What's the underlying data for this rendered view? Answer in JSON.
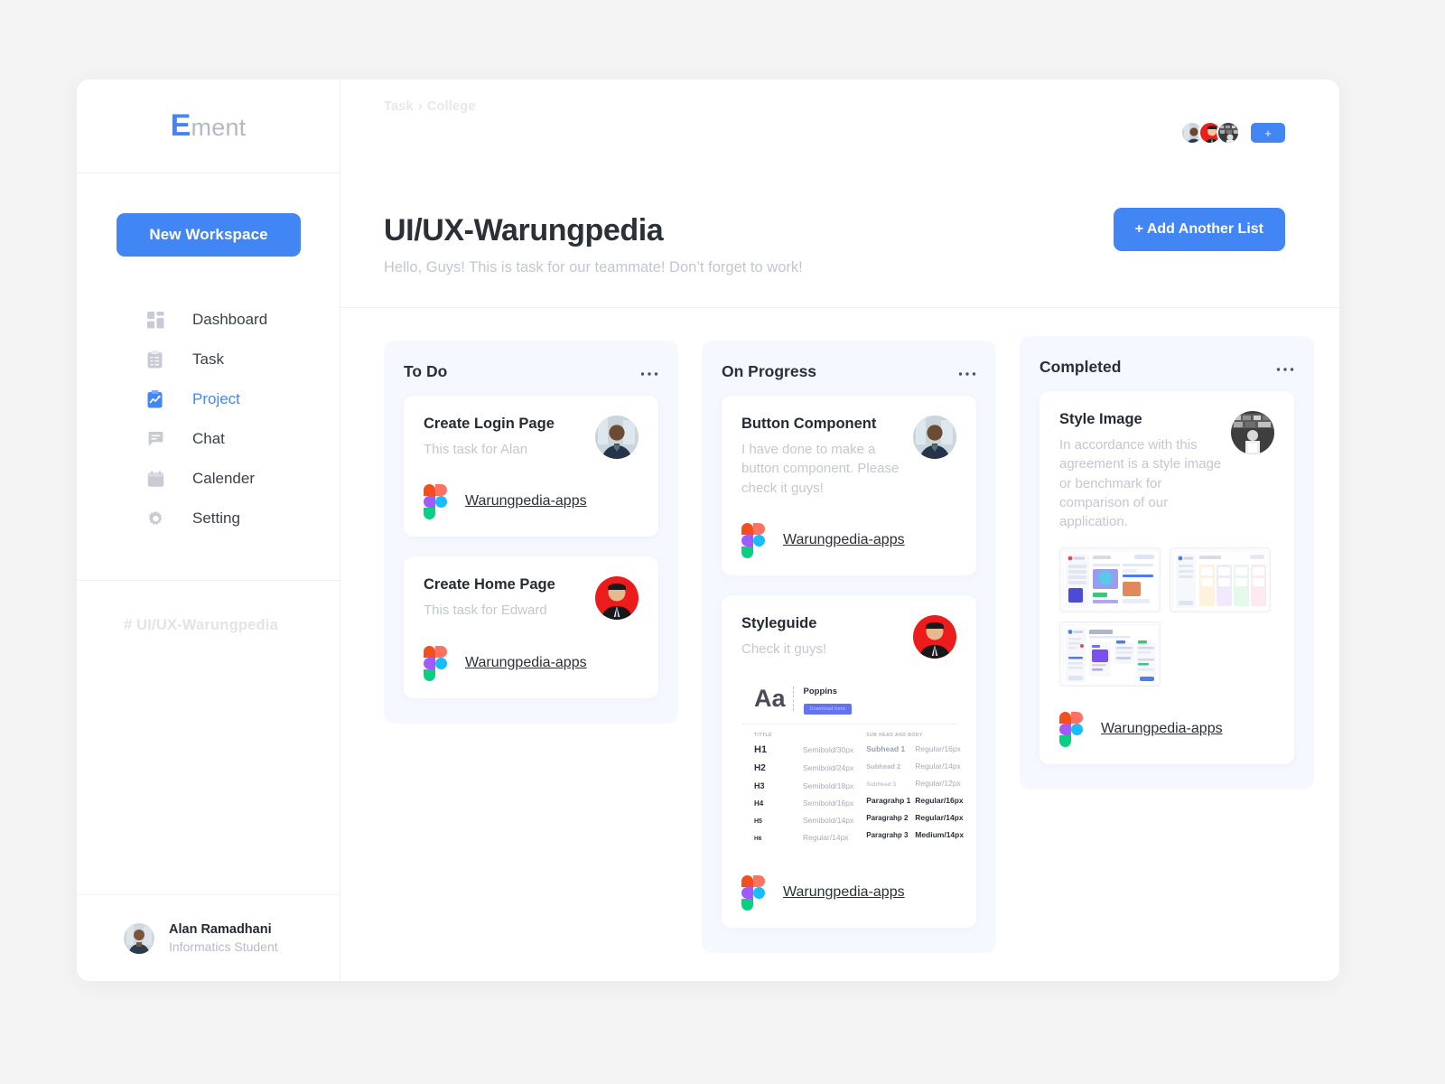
{
  "brand": {
    "logo_accent": "E",
    "logo_rest": "ment",
    "accent_color": "#4285f4"
  },
  "sidebar": {
    "new_workspace_label": "New Workspace",
    "items": [
      {
        "label": "Dashboard",
        "icon": "dashboard-icon",
        "active": false
      },
      {
        "label": "Task",
        "icon": "task-clipboard-icon",
        "active": false
      },
      {
        "label": "Project",
        "icon": "project-chart-icon",
        "active": true
      },
      {
        "label": "Chat",
        "icon": "chat-bubble-icon",
        "active": false
      },
      {
        "label": "Calender",
        "icon": "calendar-icon",
        "active": false
      },
      {
        "label": "Setting",
        "icon": "gear-icon",
        "active": false
      }
    ],
    "hashtag": "# UI/UX-Warungpedia",
    "profile": {
      "name": "Alan Ramadhani",
      "role": "Informatics Student"
    }
  },
  "header": {
    "breadcrumb_root": "Task",
    "breadcrumb_separator": "›",
    "breadcrumb_current": "College",
    "add_member_label": "+",
    "avatar_count": 3
  },
  "page": {
    "title": "UI/UX-Warungpedia",
    "subtitle": "Hello, Guys! This is task for our teammate! Don’t forget to work!",
    "add_list_label": "+ Add Another List"
  },
  "board": {
    "menu_dots": "• • •",
    "columns": [
      {
        "title": "To Do",
        "cards": [
          {
            "title": "Create Login Page",
            "desc": "This task for Alan",
            "link": "Warungpedia-apps",
            "avatar": "man-blue-blazer"
          },
          {
            "title": "Create Home Page",
            "desc": "This task for Edward",
            "link": "Warungpedia-apps",
            "avatar": "man-red-background"
          }
        ]
      },
      {
        "title": "On Progress",
        "cards": [
          {
            "title": "Button Component",
            "desc": "I have done to make a button component. Please check it guys!",
            "link": "Warungpedia-apps",
            "avatar": "man-blue-blazer"
          },
          {
            "title": "Styleguide",
            "desc": "Check it guys!",
            "link": "Warungpedia-apps",
            "avatar": "man-red-background",
            "preview": "typography-styleguide"
          }
        ]
      },
      {
        "title": "Completed",
        "cards": [
          {
            "title": "Style Image",
            "desc": "In accordance with this agreement is a style image or benchmark for comparison of our application.",
            "link": "Warungpedia-apps",
            "avatar": "grayscale-photo",
            "preview": "dashboard-thumbnails"
          }
        ]
      }
    ]
  },
  "styleguide_preview": {
    "sample_glyph": "Aa",
    "font_name": "Poppins",
    "download_label": "Download here",
    "left_header": "TITTLE",
    "right_header": "SUB HEAD AND BODY",
    "left_rows": [
      {
        "key": "H1",
        "value": "Semibold/30px"
      },
      {
        "key": "H2",
        "value": "Semibold/24px"
      },
      {
        "key": "H3",
        "value": "Semibold/18px"
      },
      {
        "key": "H4",
        "value": "Semibold/16px"
      },
      {
        "key": "H5",
        "value": "Semibold/14px"
      },
      {
        "key": "H6",
        "value": "Regular/14px"
      }
    ],
    "right_rows": [
      {
        "key": "Subhead 1",
        "value": "Regular/16px"
      },
      {
        "key": "Subhead 2",
        "value": "Regular/14px"
      },
      {
        "key": "Subhead 3",
        "value": "Regular/12px"
      },
      {
        "key": "Paragrahp 1",
        "value": "Regular/16px"
      },
      {
        "key": "Paragrahp 2",
        "value": "Regular/14px"
      },
      {
        "key": "Paragrahp 3",
        "value": "Medium/14px"
      }
    ]
  }
}
